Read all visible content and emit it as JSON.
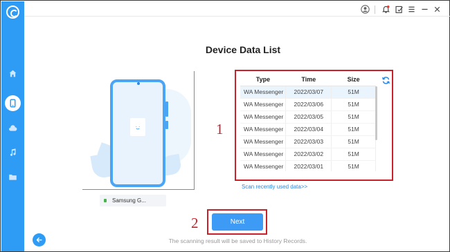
{
  "page": {
    "title": "Device Data List"
  },
  "table": {
    "headers": [
      "Type",
      "Time",
      "Size"
    ],
    "rows": [
      [
        "WA Messenger",
        "2022/03/07",
        "51M"
      ],
      [
        "WA Messenger",
        "2022/03/06",
        "51M"
      ],
      [
        "WA Messenger",
        "2022/03/05",
        "51M"
      ],
      [
        "WA Messenger",
        "2022/03/04",
        "51M"
      ],
      [
        "WA Messenger",
        "2022/03/03",
        "51M"
      ],
      [
        "WA Messenger",
        "2022/03/02",
        "51M"
      ],
      [
        "WA Messenger",
        "2022/03/01",
        "51M"
      ]
    ],
    "selected_row_index": 0
  },
  "device": {
    "name": "Samsung G..."
  },
  "scan_link": "Scan recently used data>>",
  "next_label": "Next",
  "footer_note": "The scanning result will be saved to History Records.",
  "annotations": {
    "one": "1",
    "two": "2"
  },
  "icons": {
    "sidebar": [
      "app-logo-icon",
      "home-icon",
      "phone-icon",
      "cloud-icon",
      "music-icon",
      "folder-icon"
    ],
    "topbar": [
      "user-avatar-icon",
      "notification-bell-icon",
      "edit-icon",
      "menu-icon",
      "minimize-icon",
      "close-icon"
    ],
    "table": "refresh-icon"
  },
  "colors": {
    "accent": "#2e9bf5",
    "annotation": "#c9202a",
    "link": "#2e86e0"
  }
}
